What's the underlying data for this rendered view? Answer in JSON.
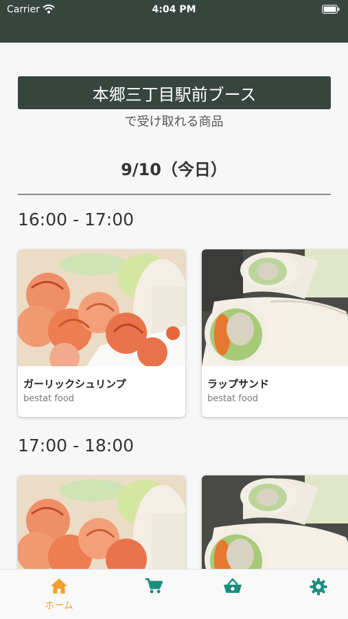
{
  "status_bar": {
    "carrier": "Carrier",
    "time": "4:04 PM"
  },
  "booth": {
    "name": "本郷三丁目駅前ブース",
    "subtitle": "で受け取れる商品"
  },
  "date_heading": "9/10（今日）",
  "slots": [
    {
      "time": "16:00 - 17:00",
      "items": [
        {
          "name": "ガーリックシュリンプ",
          "maker": "bestat food",
          "image": "garlic-shrimp"
        },
        {
          "name": "ラップサンド",
          "maker": "bestat food",
          "image": "wrap-sandwich"
        }
      ]
    },
    {
      "time": "17:00 - 18:00",
      "items": [
        {
          "name": "",
          "maker": "",
          "image": "garlic-shrimp"
        },
        {
          "name": "",
          "maker": "",
          "image": "wrap-sandwich"
        }
      ]
    }
  ],
  "tabs": [
    {
      "label": "ホーム",
      "icon": "home-icon",
      "active": true
    },
    {
      "label": "",
      "icon": "cart-icon",
      "active": false
    },
    {
      "label": "",
      "icon": "basket-icon",
      "active": false
    },
    {
      "label": "",
      "icon": "gear-icon",
      "active": false
    }
  ],
  "colors": {
    "header": "#37453f",
    "active_tab": "#f0a030",
    "inactive_tab": "#1a8f80"
  }
}
